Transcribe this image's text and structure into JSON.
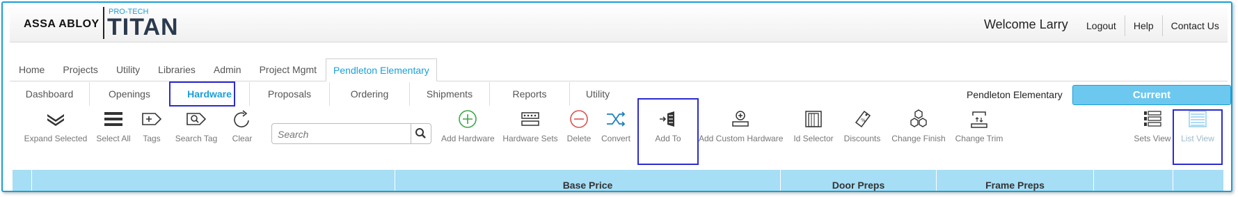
{
  "header": {
    "brand": "ASSA ABLOY",
    "product_sub": "PRO-TECH",
    "product": "TITAN",
    "welcome": "Welcome Larry",
    "links": [
      "Logout",
      "Help",
      "Contact Us"
    ]
  },
  "main_tabs": [
    "Home",
    "Projects",
    "Utility",
    "Libraries",
    "Admin",
    "Project Mgmt",
    "Pendleton Elementary"
  ],
  "main_tabs_active": "Pendleton Elementary",
  "sub_tabs": [
    "Dashboard",
    "Openings",
    "Hardware",
    "Proposals",
    "Ordering",
    "Shipments",
    "Reports",
    "Utility"
  ],
  "sub_tabs_active": "Hardware",
  "project_name": "Pendleton Elementary",
  "current_label": "Current",
  "toolbar": {
    "expand_selected": "Expand Selected",
    "select_all": "Select All",
    "tags": "Tags",
    "search_tag": "Search Tag",
    "clear": "Clear",
    "search_placeholder": "Search",
    "add_hardware": "Add Hardware",
    "hardware_sets": "Hardware Sets",
    "delete": "Delete",
    "convert": "Convert",
    "add_to": "Add To",
    "add_custom_hardware": "Add Custom Hardware",
    "id_selector": "Id Selector",
    "discounts": "Discounts",
    "change_finish": "Change Finish",
    "change_trim": "Change Trim",
    "sets_view": "Sets View",
    "list_view": "List View"
  },
  "table_headers": [
    "",
    "",
    "Base Price",
    "Door Preps",
    "Frame Preps",
    "",
    ""
  ],
  "colors": {
    "accent": "#1a9fd8",
    "table_header": "#a6def5",
    "highlight_box": "#2b2bd0",
    "add_icon": "#3aa845",
    "delete_icon": "#d9534f"
  }
}
